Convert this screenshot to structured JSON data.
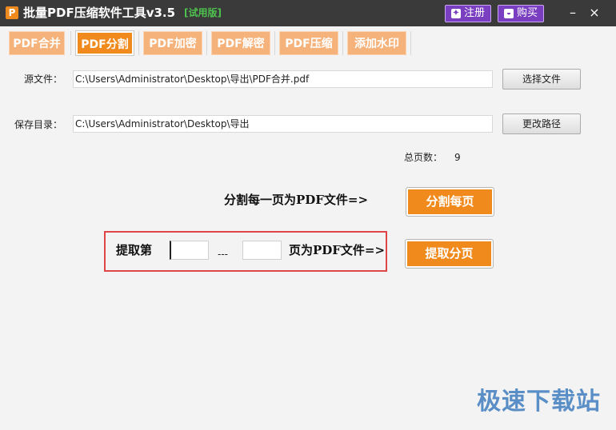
{
  "window": {
    "logo": "P",
    "title": "批量PDF压缩软件工具v3.5",
    "trial": "[试用版]",
    "register_label": "注册",
    "buy_label": "购买",
    "minimize": "–",
    "close": "×"
  },
  "tabs": [
    {
      "label": "PDF合并"
    },
    {
      "label": "PDF分割",
      "active": true
    },
    {
      "label": "PDF加密"
    },
    {
      "label": "PDF解密"
    },
    {
      "label": "PDF压缩"
    },
    {
      "label": "添加水印"
    }
  ],
  "source": {
    "label": "源文件：",
    "value": "C:\\Users\\Administrator\\Desktop\\导出\\PDF合并.pdf",
    "button": "选择文件"
  },
  "save": {
    "label": "保存目录：",
    "value": "C:\\Users\\Administrator\\Desktop\\导出",
    "button": "更改路径"
  },
  "pages": {
    "label": "总页数：",
    "value": "9"
  },
  "split_each": {
    "label": "分割每一页为PDF文件=>",
    "button": "分割每页"
  },
  "extract": {
    "prefix": "提取第",
    "from": "",
    "separator": "---",
    "to": "",
    "suffix": "页为PDF文件=>",
    "button": "提取分页"
  },
  "watermark": "极速下载站",
  "colors": {
    "accent": "#f08a1c",
    "tab_inactive": "#f5b27a",
    "titlebar": "#3a3a3a",
    "purple": "#7a3fc0",
    "highlight": "#e04444"
  }
}
